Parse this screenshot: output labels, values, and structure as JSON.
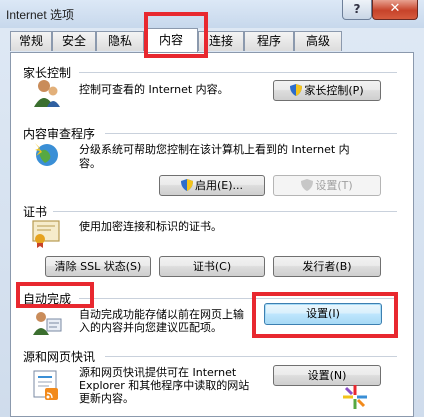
{
  "window": {
    "title": "Internet 选项",
    "help": "?",
    "close": "✕"
  },
  "tabs": [
    {
      "label": "常规"
    },
    {
      "label": "安全"
    },
    {
      "label": "隐私"
    },
    {
      "label": "内容"
    },
    {
      "label": "连接"
    },
    {
      "label": "程序"
    },
    {
      "label": "高级"
    }
  ],
  "parental": {
    "title": "家长控制",
    "desc": "控制可查看的 Internet 内容。",
    "button": "家长控制(P)"
  },
  "advisor": {
    "title": "内容审查程序",
    "desc_line1": "分级系统可帮助您控制在该计算机上看到的 Internet 内",
    "desc_line2": "容。",
    "enable_button": "启用(E)...",
    "settings_button": "设置(T)"
  },
  "certificates": {
    "title": "证书",
    "desc": "使用加密连接和标识的证书。",
    "clear_ssl": "清除 SSL 状态(S)",
    "certs": "证书(C)",
    "publishers": "发行者(B)"
  },
  "autocomplete": {
    "title": "自动完成",
    "desc_line1": "自动完成功能存储以前在网页上输",
    "desc_line2": "入的内容并向您建议匹配项。",
    "settings_button": "设置(I)"
  },
  "feeds": {
    "title": "源和网页快讯",
    "desc_line1": "源和网页快讯提供可在 Internet",
    "desc_line2": "Explorer 和其他程序中读取的网站",
    "desc_line3": "更新内容。",
    "settings_button": "设置(N)"
  },
  "colors": {
    "highlight": "#e8282f",
    "panel_border": "#8b99ad"
  }
}
